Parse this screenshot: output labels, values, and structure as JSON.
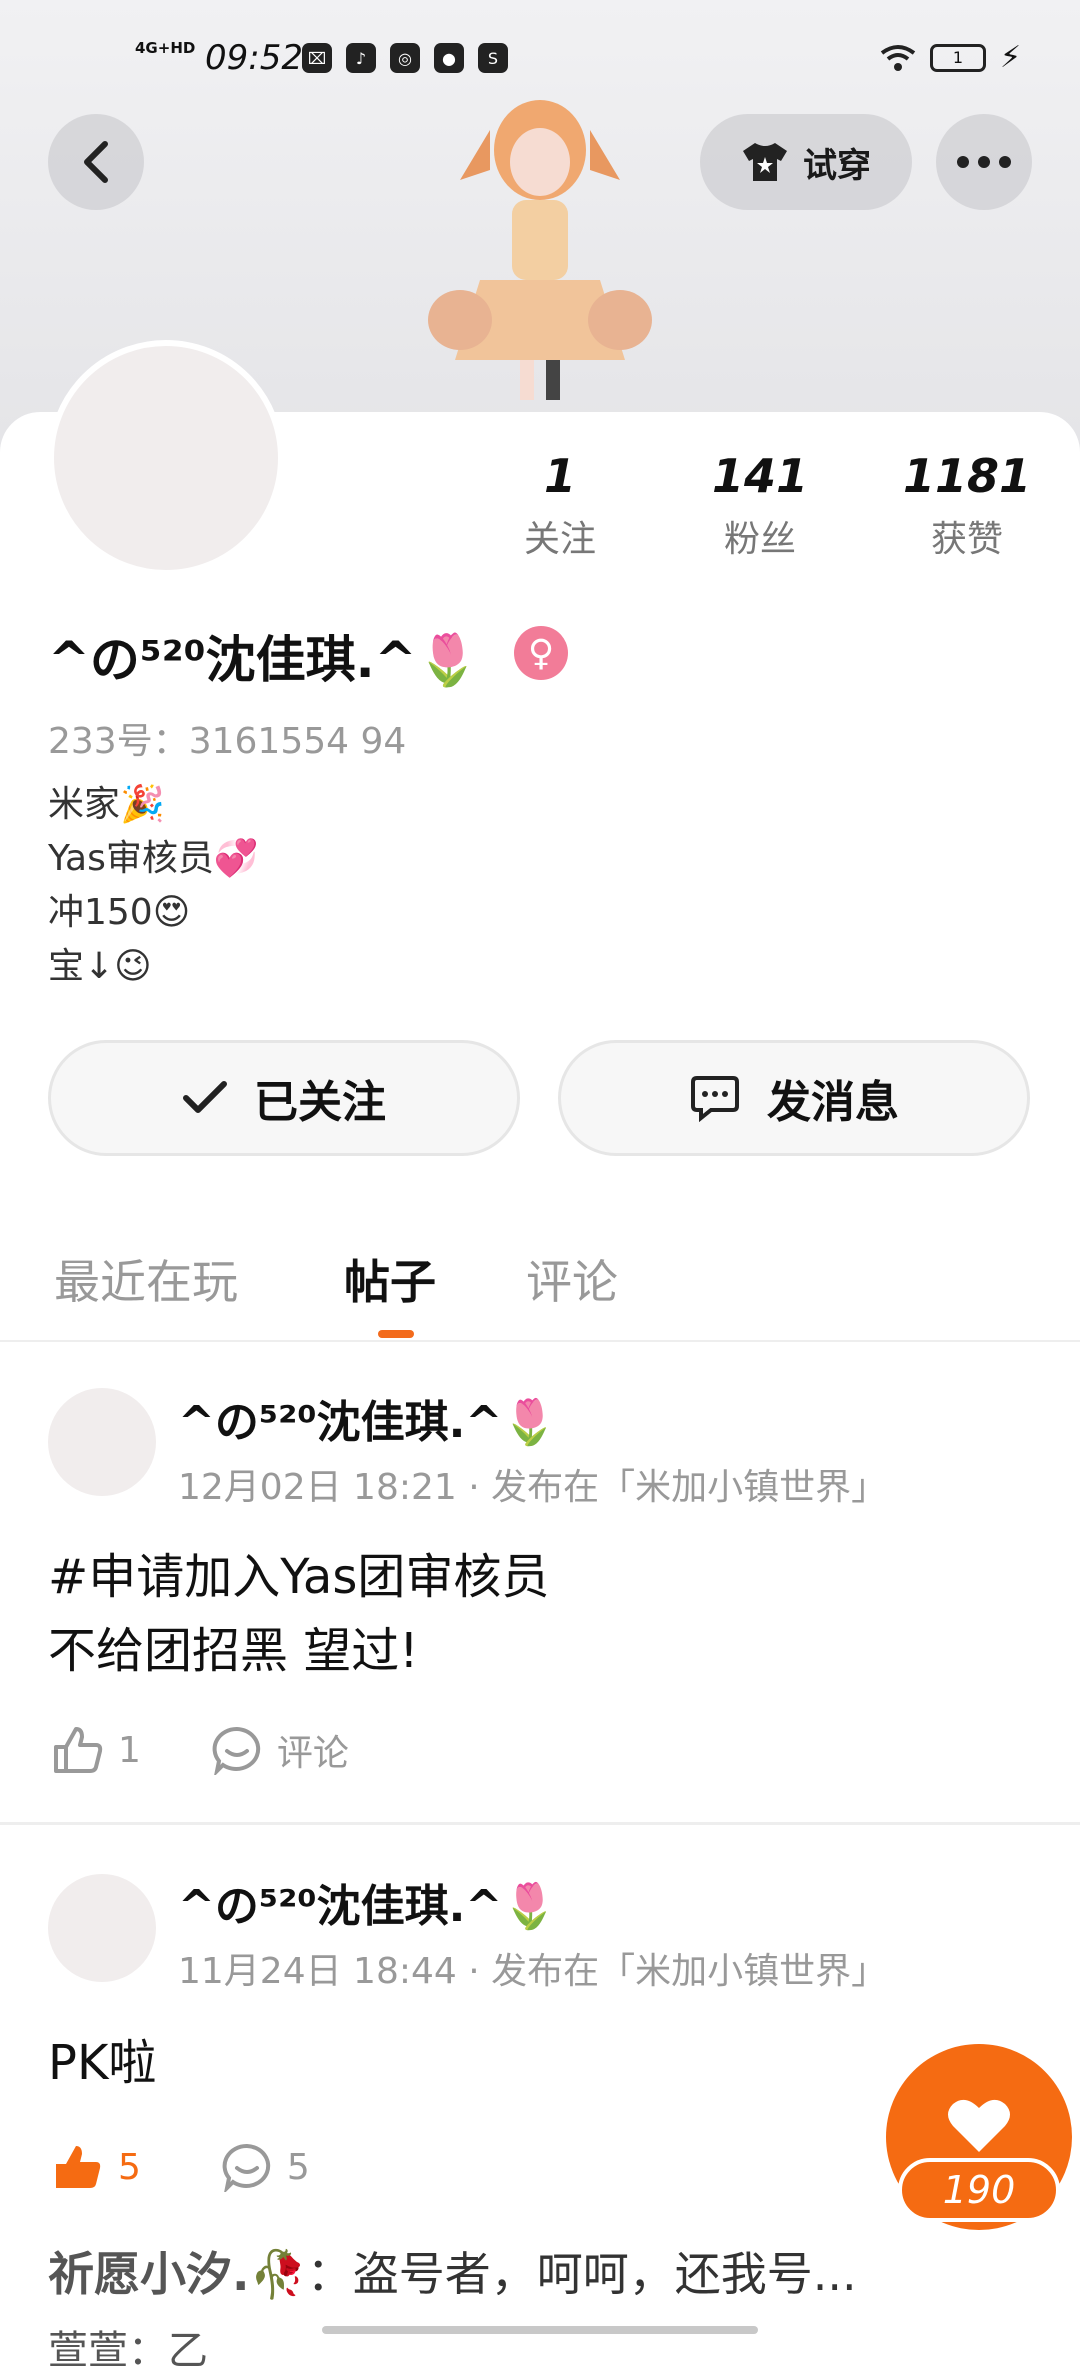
{
  "status_bar": {
    "network": "4G+HD",
    "time": "09:52",
    "apps": [
      "⌧",
      "♪",
      "◎",
      "●",
      "S"
    ],
    "battery": "1"
  },
  "header": {
    "tryon_label": "试穿"
  },
  "profile": {
    "stats": [
      {
        "value": "1",
        "label": "关注"
      },
      {
        "value": "141",
        "label": "粉丝"
      },
      {
        "value": "1181",
        "label": "获赞"
      }
    ],
    "nickname": "^の⁵²⁰沈佳琪.^🌷",
    "gender_symbol": "♀",
    "user_id": "233号：3161554 94",
    "bio": [
      "米家🎉",
      "Yas审核员💞",
      "冲150😍",
      "宝↓😉"
    ]
  },
  "actions": {
    "follow_label": "已关注",
    "message_label": "发消息"
  },
  "tabs": [
    {
      "label": "最近在玩"
    },
    {
      "label": "帖子"
    },
    {
      "label": "评论"
    }
  ],
  "posts": [
    {
      "author": "^の⁵²⁰沈佳琪.^🌷",
      "meta": "12月02日  18:21 · 发布在「米加小镇世界」",
      "content": "#申请加入Yas团审核员\n不给团招黑  望过!",
      "likes": "1",
      "comments": "评论"
    },
    {
      "author": "^の⁵²⁰沈佳琪.^🌷",
      "meta": "11月24日  18:44 · 发布在「米加小镇世界」",
      "content": "PK啦",
      "likes": "5",
      "comments": "5"
    }
  ],
  "comment_preview": {
    "author": "祈愿小汐.🥀",
    "text": "：盗号者，呵呵，还我号...",
    "next": "萱萱：乙"
  },
  "like_fab": {
    "count": "190"
  },
  "colors": {
    "accent": "#f56b12",
    "gender": "#f27c98"
  }
}
